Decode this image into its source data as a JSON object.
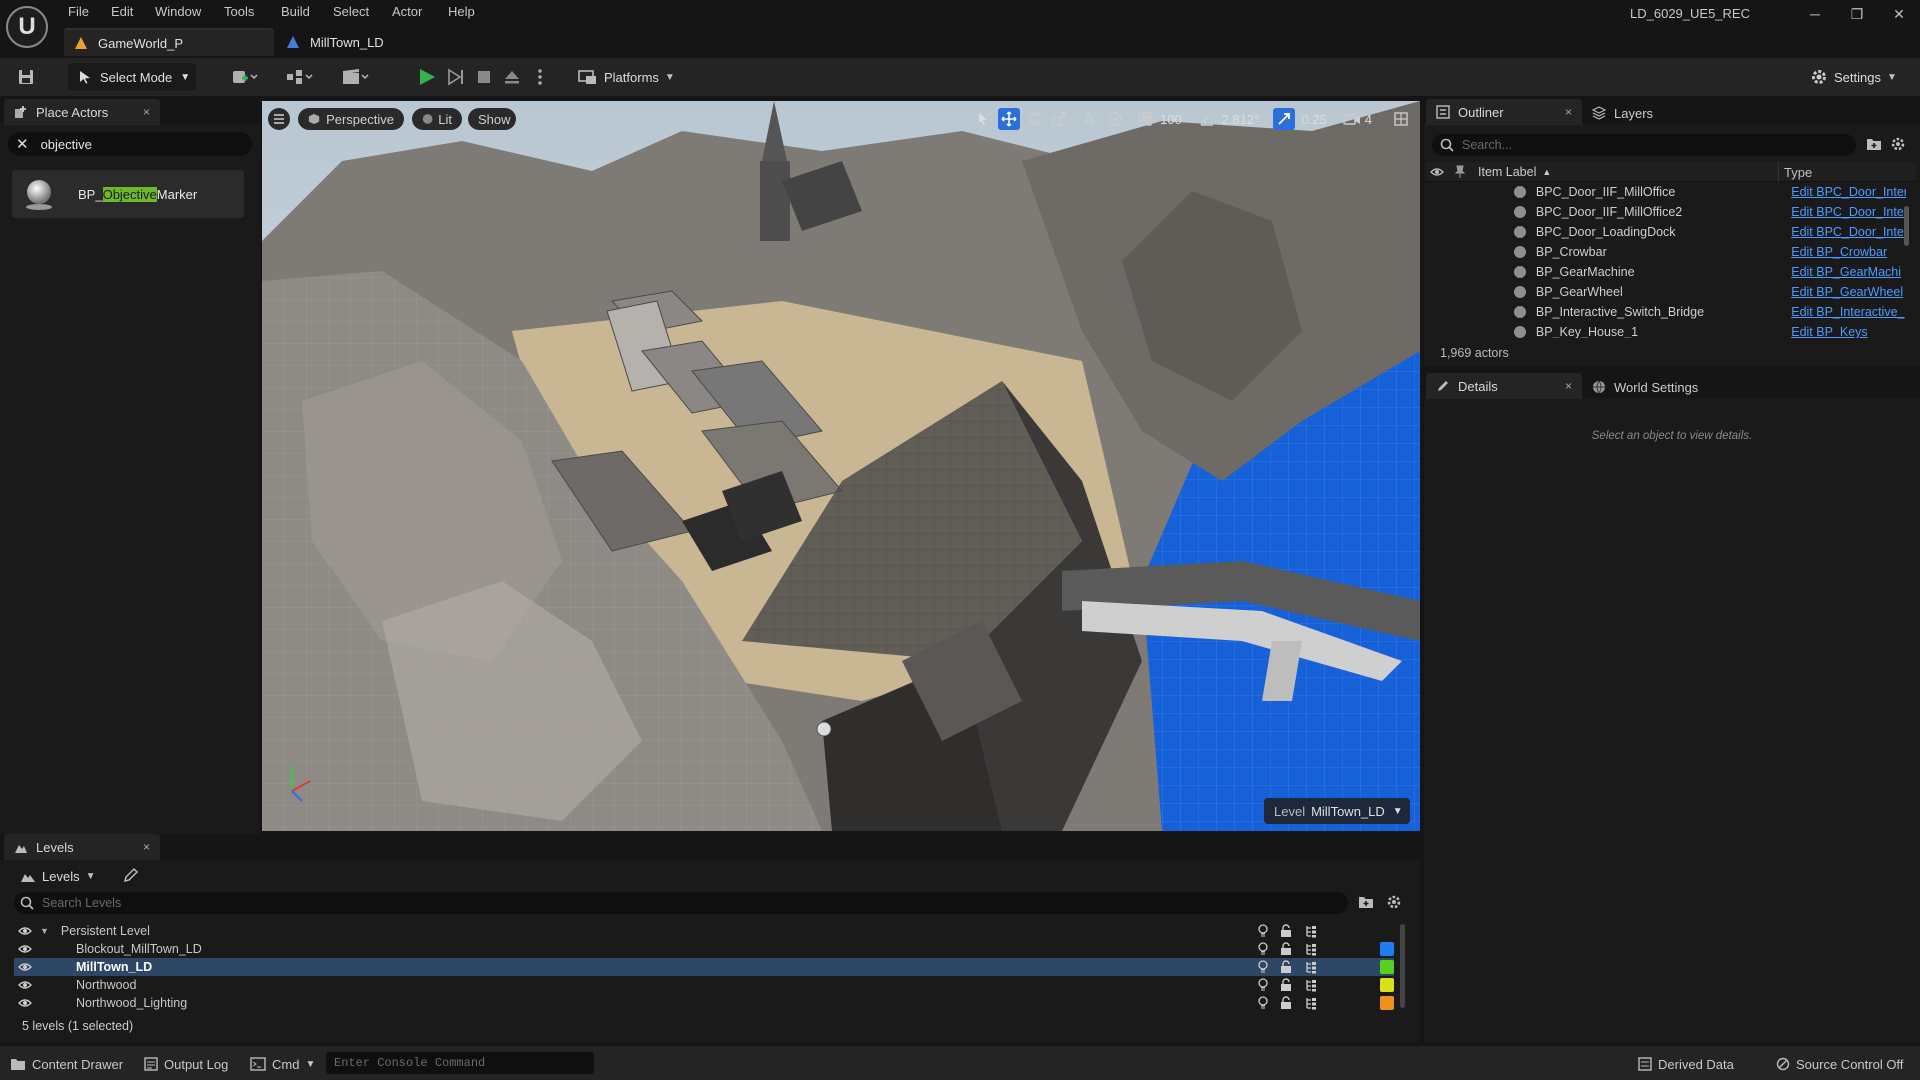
{
  "app": {
    "logo_text": "U",
    "menu": [
      "File",
      "Edit",
      "Window",
      "Tools",
      "Build",
      "Select",
      "Actor",
      "Help"
    ],
    "project_name": "LD_6029_UE5_REC",
    "tabs": [
      {
        "label": "GameWorld_P"
      },
      {
        "label": "MillTown_LD"
      }
    ]
  },
  "toolbar": {
    "select_mode_label": "Select Mode",
    "platforms_label": "Platforms",
    "settings_label": "Settings",
    "play_color": "#36b24a"
  },
  "place_actors": {
    "tab_label": "Place Actors",
    "close": "×",
    "search_value": "objective",
    "result": {
      "prefix": "BP_",
      "highlight": "Objective",
      "suffix": "Marker"
    }
  },
  "viewport": {
    "view_mode": "Perspective",
    "lighting": "Lit",
    "show_label": "Show",
    "grid_snap": "100",
    "rotation_snap": "2.812°",
    "scale_snap": "0.25",
    "camera_speed": "4",
    "level_label": "Level",
    "level_name": "MillTown_LD"
  },
  "outliner": {
    "tab_label": "Outliner",
    "layers_label": "Layers",
    "close": "×",
    "search_placeholder": "Search...",
    "col_label": "Item Label",
    "col_type": "Type",
    "items": [
      {
        "label": "BPC_Door_IIF_MillOffice",
        "type": "Edit BPC_Door_Inter"
      },
      {
        "label": "BPC_Door_IIF_MillOffice2",
        "type": "Edit BPC_Door_Inter"
      },
      {
        "label": "BPC_Door_LoadingDock",
        "type": "Edit BPC_Door_Inter"
      },
      {
        "label": "BP_Crowbar",
        "type": "Edit BP_Crowbar"
      },
      {
        "label": "BP_GearMachine",
        "type": "Edit BP_GearMachi"
      },
      {
        "label": "BP_GearWheel",
        "type": "Edit BP_GearWheel"
      },
      {
        "label": "BP_Interactive_Switch_Bridge",
        "type": "Edit BP_Interactive_"
      },
      {
        "label": "BP_Key_House_1",
        "type": "Edit BP_Keys"
      }
    ],
    "actor_count": "1,969 actors"
  },
  "details": {
    "tab_label": "Details",
    "world_settings_label": "World Settings",
    "close": "×",
    "empty_text": "Select an object to view details."
  },
  "levels": {
    "tab_label": "Levels",
    "close": "×",
    "dropdown_label": "Levels",
    "search_placeholder": "Search Levels",
    "rows": [
      {
        "name": "Persistent Level",
        "color": ""
      },
      {
        "name": "Blockout_MillTown_LD",
        "color": "#1e7df0"
      },
      {
        "name": "MillTown_LD",
        "color": "#55d21b"
      },
      {
        "name": "Northwood",
        "color": "#d8e21a"
      },
      {
        "name": "Northwood_Lighting",
        "color": "#f0901a"
      }
    ],
    "summary": "5 levels (1 selected)"
  },
  "statusbar": {
    "content_drawer": "Content Drawer",
    "output_log": "Output Log",
    "cmd": "Cmd",
    "console_placeholder": "Enter Console Command",
    "derived_data": "Derived Data",
    "source_control": "Source Control Off"
  }
}
